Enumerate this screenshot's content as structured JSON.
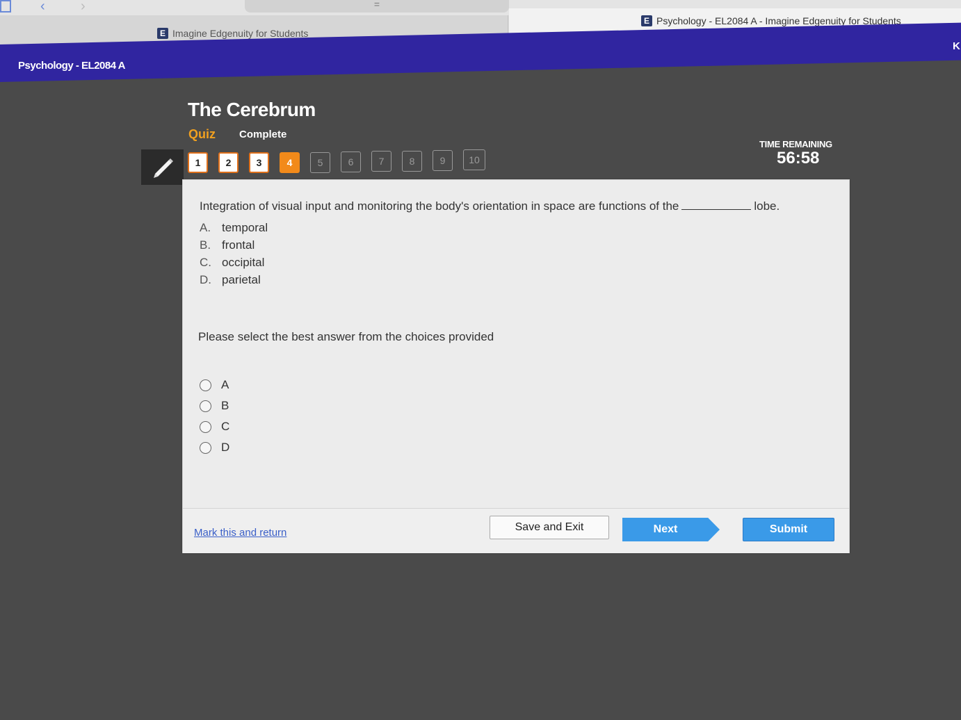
{
  "browser": {
    "back_icon": "chevron-left-icon",
    "forward_icon": "chevron-right-icon",
    "url_handle": "=",
    "tabs": [
      {
        "title": "Imagine Edgenuity for Students"
      },
      {
        "title": "Psychology - EL2084 A - Imagine Edgenuity for Students"
      }
    ],
    "close_glyph": "x"
  },
  "header": {
    "course_name": "Psychology - EL2084 A",
    "right_initial": "K",
    "bar_color": "#3025a0"
  },
  "lesson": {
    "title": "The Cerebrum",
    "activity_type": "Quiz",
    "status": "Complete"
  },
  "question_nav": {
    "items": [
      {
        "label": "1",
        "state": "answered"
      },
      {
        "label": "2",
        "state": "answered"
      },
      {
        "label": "3",
        "state": "answered"
      },
      {
        "label": "4",
        "state": "current"
      },
      {
        "label": "5",
        "state": "pending"
      },
      {
        "label": "6",
        "state": "pending"
      },
      {
        "label": "7",
        "state": "pending"
      },
      {
        "label": "8",
        "state": "pending"
      },
      {
        "label": "9",
        "state": "pending"
      },
      {
        "label": "10",
        "state": "pending"
      }
    ]
  },
  "timer": {
    "label": "TIME REMAINING",
    "value": "56:58"
  },
  "question": {
    "prompt_before": "Integration of visual input and monitoring the body's orientation in space are functions of the",
    "prompt_after": "lobe.",
    "choices": [
      {
        "letter": "A.",
        "text": "temporal"
      },
      {
        "letter": "B.",
        "text": "frontal"
      },
      {
        "letter": "C.",
        "text": "occipital"
      },
      {
        "letter": "D.",
        "text": "parietal"
      }
    ],
    "instruction": "Please select the best answer from the choices provided",
    "answers": [
      "A",
      "B",
      "C",
      "D"
    ]
  },
  "footer": {
    "mark_link": "Mark this and return",
    "save_label": "Save and Exit",
    "next_label": "Next",
    "submit_label": "Submit"
  }
}
